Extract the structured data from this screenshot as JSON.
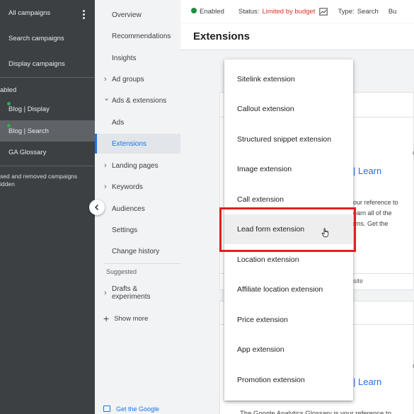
{
  "campaigns": {
    "all_campaigns": "All campaigns",
    "search_campaigns": "Search campaigns",
    "display_campaigns": "Display campaigns",
    "enabled_heading": "abled",
    "items": [
      "Blog | Display",
      "Blog | Search",
      "GA Glossary"
    ],
    "hidden_note_line1": "sed and removed campaigns",
    "hidden_note_line2": "idden"
  },
  "nav": {
    "overview": "Overview",
    "recommendations": "Recommendations",
    "insights": "Insights",
    "ad_groups": "Ad groups",
    "ads_extensions": "Ads & extensions",
    "ads": "Ads",
    "extensions": "Extensions",
    "landing_pages": "Landing pages",
    "keywords": "Keywords",
    "audiences": "Audiences",
    "settings": "Settings",
    "change_history": "Change history",
    "suggested": "Suggested",
    "drafts_line1": "Drafts &",
    "drafts_line2": "experiments",
    "show_more": "Show more",
    "footer": "Get the Google"
  },
  "status_bar": {
    "enabled": "Enabled",
    "status_label": "Status:",
    "status_value": "Limited by budget",
    "type_label": "Type:",
    "type_value": "Search",
    "budget_fragment": "Bu"
  },
  "page_title": "Extensions",
  "cards": {
    "link1": "| Learn",
    "text1_line1": "our reference to",
    "text1_line2": "earn all of the",
    "text1_line3": "rms. Get the",
    "site_fragment": "site",
    "link2": "| Learn",
    "bottom_text": "The Google Analytics Glossary is your reference to",
    "corner_c1": "c",
    "corner_c2": "c"
  },
  "menu": {
    "items": [
      "Sitelink extension",
      "Callout extension",
      "Structured snippet extension",
      "Image extension",
      "Call extension",
      "Lead form extension",
      "Location extension",
      "Affiliate location extension",
      "Price extension",
      "App extension",
      "Promotion extension"
    ],
    "hovered_index": 5
  },
  "colors": {
    "accent": "#1a73e8",
    "status_limited": "#d93025",
    "enabled_green": "#1e8e3e",
    "highlight_red": "#e02020"
  }
}
